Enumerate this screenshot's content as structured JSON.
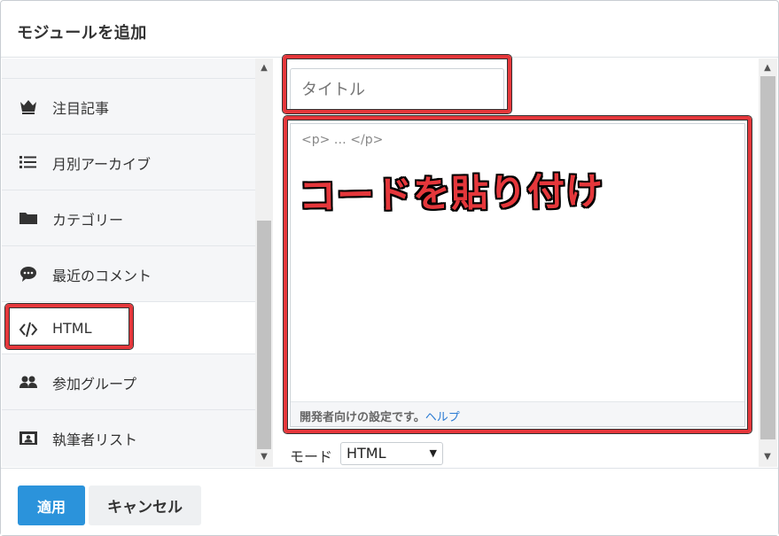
{
  "dialog": {
    "title": "モジュールを追加"
  },
  "sidebar": {
    "items": [
      {
        "label": "注目記事",
        "icon": "crown-icon"
      },
      {
        "label": "月別アーカイブ",
        "icon": "list-icon"
      },
      {
        "label": "カテゴリー",
        "icon": "folder-icon"
      },
      {
        "label": "最近のコメント",
        "icon": "comment-icon"
      },
      {
        "label": "HTML",
        "icon": "code-icon",
        "active": true
      },
      {
        "label": "参加グループ",
        "icon": "users-icon"
      },
      {
        "label": "執筆者リスト",
        "icon": "id-card-icon"
      }
    ]
  },
  "editor": {
    "title_placeholder": "タイトル",
    "code_placeholder": "<p> … </p>",
    "footer_text": "開発者向けの設定です。",
    "help_link": "ヘルプ",
    "overlay_caption": "コードを貼り付け",
    "mode_label": "モード",
    "mode_value": "HTML"
  },
  "footer": {
    "apply_label": "適用",
    "cancel_label": "キャンセル"
  },
  "colors": {
    "accent": "#2b93db",
    "highlight_red": "#e5373b",
    "link": "#2b7bd3"
  }
}
